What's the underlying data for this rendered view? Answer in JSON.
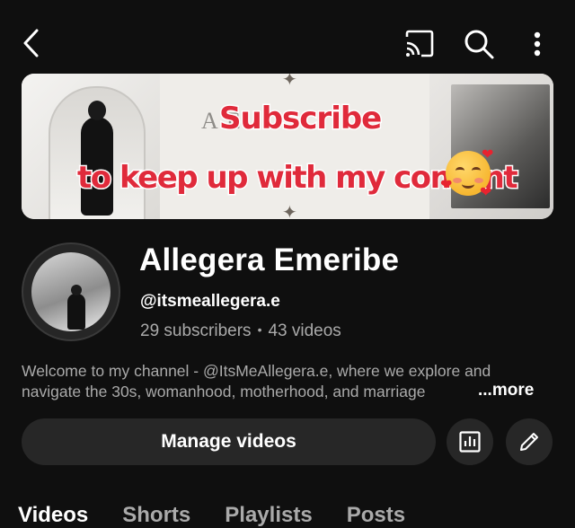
{
  "topbar": {
    "back_icon": "chevron-left-icon",
    "cast_icon": "cast-icon",
    "search_icon": "search-icon",
    "more_icon": "more-vertical-icon"
  },
  "banner": {
    "faint_text": "A       E.",
    "headline": "Subscribe",
    "subline": "to keep up with my content",
    "emoji": "smiling-face-with-hearts",
    "text_color": "#e02a3b"
  },
  "channel": {
    "name": "Allegera Emeribe",
    "handle": "@itsmeallegera.e",
    "subscribers": "29 subscribers",
    "separator": "•",
    "videos": "43 videos",
    "description_line1": "Welcome to my channel - @ItsMeAllegera.e, where we explore and",
    "description_line2": "navigate the 30s, womanhood, motherhood, and marriage",
    "more_label": "...more"
  },
  "actions": {
    "manage_label": "Manage videos",
    "analytics_icon": "analytics-icon",
    "edit_icon": "pencil-icon"
  },
  "tabs": [
    {
      "label": "Videos",
      "active": true
    },
    {
      "label": "Shorts",
      "active": false
    },
    {
      "label": "Playlists",
      "active": false
    },
    {
      "label": "Posts",
      "active": false
    }
  ]
}
